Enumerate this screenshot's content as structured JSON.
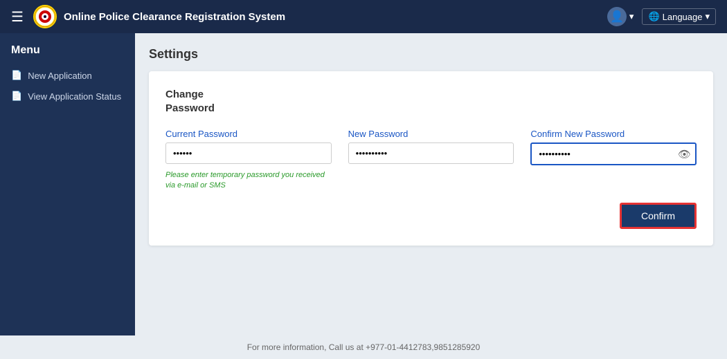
{
  "navbar": {
    "hamburger_icon": "☰",
    "title": "Online Police Clearance Registration System",
    "user_icon": "👤",
    "user_caret": "▾",
    "language_icon": "🌐",
    "language_label": "Language",
    "language_caret": "▾"
  },
  "sidebar": {
    "menu_label": "Menu",
    "items": [
      {
        "label": "New Application",
        "icon": "📄"
      },
      {
        "label": "View Application Status",
        "icon": "📄"
      }
    ]
  },
  "settings": {
    "page_title": "Settings",
    "card": {
      "section_title": "Change\nPassword",
      "current_password_label": "Current Password",
      "current_password_value": "••••••",
      "current_password_helper": "Please enter temporary password you received via e-mail or SMS",
      "new_password_label": "New Password",
      "new_password_value": "••••••••••",
      "confirm_password_label": "Confirm New Password",
      "confirm_password_value": "••••••••••",
      "confirm_button_label": "Confirm"
    }
  },
  "footer": {
    "text": "For more information, Call us at +977-01-4412783,9851285920"
  }
}
